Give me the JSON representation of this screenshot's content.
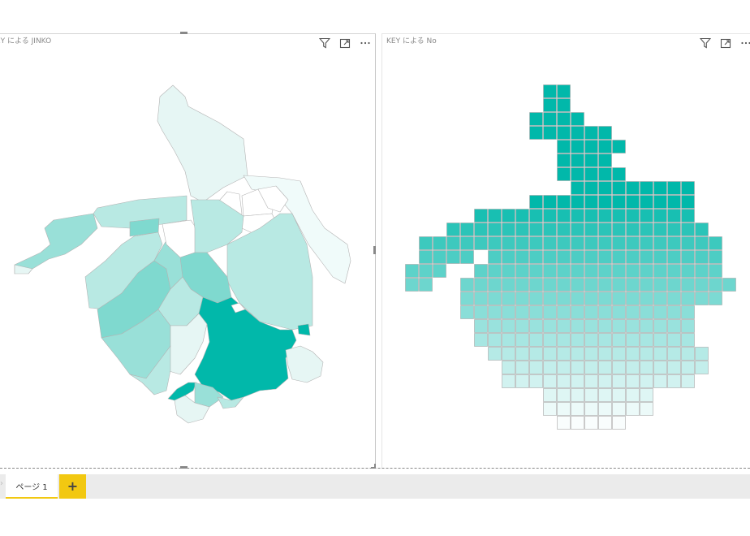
{
  "visuals": [
    {
      "title": "EY による JINKO",
      "icons": [
        "filter-icon",
        "focus-mode-icon",
        "more-options-icon"
      ],
      "type": "filled-map",
      "colors": {
        "low": "#e6f6f4",
        "mid": "#7fd9cf",
        "high": "#01b8aa",
        "border": "#b3b3b3"
      }
    },
    {
      "title": "KEY による No",
      "icons": [
        "filter-icon",
        "focus-mode-icon",
        "more-options-icon"
      ],
      "type": "grid-map",
      "colors": {
        "top": "#01b8aa",
        "bottom": "#ffffff",
        "border": "#a8a8a8"
      }
    }
  ],
  "tabs": {
    "pages": [
      "ページ 1"
    ],
    "active": 0,
    "add_label": "+"
  },
  "accent": "#f2c811"
}
